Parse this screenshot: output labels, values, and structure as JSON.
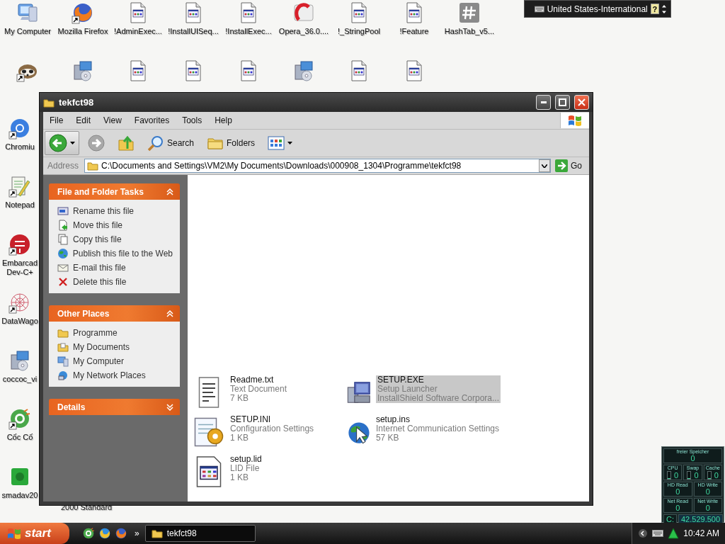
{
  "language_bar": {
    "layout": "United States-International",
    "help": "?"
  },
  "desktop_icons": [
    {
      "label": "My Computer",
      "kind": "computer",
      "shortcut": false
    },
    {
      "label": "Mozilla Firefox",
      "kind": "firefox",
      "shortcut": true
    },
    {
      "label": "!AdminExec...",
      "kind": "doc",
      "shortcut": false
    },
    {
      "label": "!InstallUISeq...",
      "kind": "doc",
      "shortcut": false
    },
    {
      "label": "!InstallExec...",
      "kind": "doc",
      "shortcut": false
    },
    {
      "label": "Opera_36.0....",
      "kind": "opera",
      "shortcut": false
    },
    {
      "label": "!_StringPool",
      "kind": "doc",
      "shortcut": false
    },
    {
      "label": "!Feature",
      "kind": "doc",
      "shortcut": false
    },
    {
      "label": "HashTab_v5...",
      "kind": "hash",
      "shortcut": false
    }
  ],
  "desktop_icons_row2": [
    {
      "kind": "mypal",
      "shortcut": true
    },
    {
      "kind": "setup",
      "shortcut": false
    },
    {
      "kind": "doc",
      "shortcut": false
    },
    {
      "kind": "doc",
      "shortcut": false
    },
    {
      "kind": "doc",
      "shortcut": false
    },
    {
      "kind": "installer",
      "shortcut": false
    },
    {
      "kind": "doc",
      "shortcut": false
    },
    {
      "kind": "doc",
      "shortcut": false
    }
  ],
  "desktop_icons_left": [
    {
      "lines": [
        "Chromiu"
      ],
      "kind": "chromium",
      "shortcut": true
    },
    {
      "lines": [
        "Notepad"
      ],
      "kind": "notepad",
      "shortcut": true
    },
    {
      "lines": [
        "Embarcad",
        "Dev-C+"
      ],
      "kind": "dev",
      "shortcut": true
    },
    {
      "lines": [
        "DataWago"
      ],
      "kind": "datawago",
      "shortcut": true
    },
    {
      "lines": [
        "coccoc_vi"
      ],
      "kind": "installer",
      "shortcut": false
    },
    {
      "lines": [
        "Cốc Cố"
      ],
      "kind": "coccoc",
      "shortcut": true
    },
    {
      "lines": [
        "smadav20"
      ],
      "kind": "smadav",
      "shortcut": false
    }
  ],
  "hidden_icon_label": "2000 Standard",
  "explorer": {
    "title": "tekfct98",
    "menu": [
      "File",
      "Edit",
      "View",
      "Favorites",
      "Tools",
      "Help"
    ],
    "toolbar": [
      {
        "kind": "back",
        "disabled": false
      },
      {
        "kind": "forward",
        "disabled": true
      },
      {
        "kind": "up",
        "disabled": false
      },
      {
        "kind": "search",
        "label": "Search",
        "disabled": false
      },
      {
        "kind": "folders",
        "label": "Folders",
        "disabled": false
      },
      {
        "kind": "views",
        "disabled": false
      }
    ],
    "address": {
      "label": "Address",
      "value": "C:\\Documents and Settings\\VM2\\My Documents\\Downloads\\000908_1304\\Programme\\tekfct98",
      "go": "Go"
    },
    "task_panels": [
      {
        "title": "File and Folder Tasks",
        "expanded": true,
        "items": [
          {
            "label": "Rename this file",
            "kind": "rename"
          },
          {
            "label": "Move this file",
            "kind": "move"
          },
          {
            "label": "Copy this file",
            "kind": "copy"
          },
          {
            "label": "Publish this file to the Web",
            "kind": "publish"
          },
          {
            "label": "E-mail this file",
            "kind": "email"
          },
          {
            "label": "Delete this file",
            "kind": "delete"
          }
        ]
      },
      {
        "title": "Other Places",
        "expanded": true,
        "items": [
          {
            "label": "Programme",
            "kind": "folder"
          },
          {
            "label": "My Documents",
            "kind": "documents"
          },
          {
            "label": "My Computer",
            "kind": "computer"
          },
          {
            "label": "My Network Places",
            "kind": "network"
          }
        ]
      },
      {
        "title": "Details",
        "expanded": false
      }
    ],
    "files": [
      {
        "name": "Readme.txt",
        "details": [
          "Text Document",
          "7 KB"
        ],
        "kind": "text",
        "selected": false
      },
      {
        "name": "SETUP.EXE",
        "details": [
          "Setup Launcher",
          "InstallShield Software Corpora..."
        ],
        "kind": "setup",
        "selected": true
      },
      {
        "name": "SETUP.INI",
        "details": [
          "Configuration Settings",
          "1 KB"
        ],
        "kind": "ini",
        "selected": false
      },
      {
        "name": "setup.ins",
        "details": [
          "Internet Communication Settings",
          "57 KB"
        ],
        "kind": "ins",
        "selected": false
      },
      {
        "name": "setup.lid",
        "details": [
          "LID File",
          "1 KB"
        ],
        "kind": "lid",
        "selected": false
      }
    ]
  },
  "system_monitor": {
    "title": "freier Speicher",
    "value": "0",
    "meters": [
      {
        "label": "CPU",
        "value": "0",
        "level": 0
      },
      {
        "label": "Swap",
        "value": "0",
        "level": 0
      },
      {
        "label": "Cache",
        "value": "0",
        "level": 0
      }
    ],
    "counters": [
      {
        "label": "HD Read",
        "value": "0"
      },
      {
        "label": "HD Write",
        "value": "0"
      },
      {
        "label": "Net Read",
        "value": "0"
      },
      {
        "label": "Net Write",
        "value": "0"
      }
    ],
    "drive": {
      "label": "C:",
      "value": "42.529.500"
    }
  },
  "taskbar": {
    "start": "start",
    "quick_launch": [
      {
        "kind": "coccoc"
      },
      {
        "kind": "ie"
      },
      {
        "kind": "firefox"
      }
    ],
    "more": "»",
    "tasks": [
      {
        "label": "tekfct98",
        "selected": true
      }
    ],
    "clock": "10:42 AM"
  }
}
